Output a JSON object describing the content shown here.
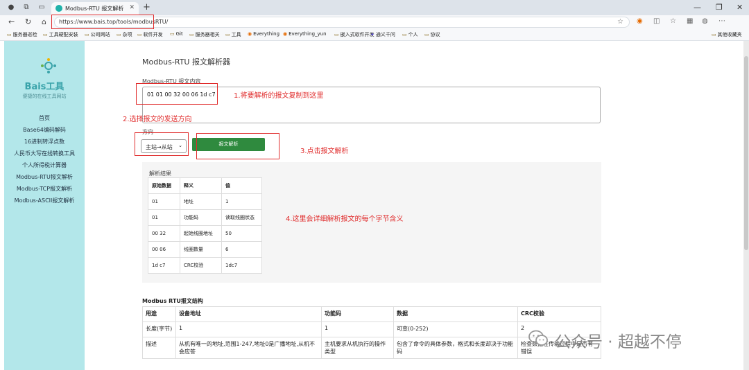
{
  "browser": {
    "tab_title": "Modbus-RTU 报文解析",
    "url": "https://www.bais.top/tools/modbusRTU/",
    "bookmarks": [
      "服务器巡检",
      "工具硬配安装",
      "公司网站",
      "杂项",
      "软件开发",
      "Git",
      "服务器相关",
      "工具",
      "Everything",
      "Everything_yun",
      "嵌入式软件开发",
      "通义千问",
      "个人",
      "协议"
    ],
    "other_bookmarks": "其他收藏夹"
  },
  "sidebar": {
    "brand": "Bais工具",
    "slogan": "便捷的在线工具网站",
    "items": [
      "首页",
      "Base64编码解码",
      "16进制转浮点数",
      "人民币大写在线转换工具",
      "个人所得税计算器",
      "Modbus-RTU报文解析",
      "Modbus-TCP报文解析",
      "Modbus-ASCII报文解析"
    ]
  },
  "main": {
    "title": "Modbus-RTU 报文解析器",
    "input_label": "Modbus-RTU 报文内容",
    "input_value": "01 01 00 32 00 06 1d c7",
    "direction_label": "方向",
    "direction_value": "主站→从站",
    "parse_button": "报文解析",
    "result_title": "解析结果",
    "result_headers": [
      "原始数据",
      "释义",
      "值"
    ],
    "result_rows": [
      [
        "01",
        "地址",
        "1"
      ],
      [
        "01",
        "功能码",
        "读取线圈状态"
      ],
      [
        "00 32",
        "起始线圈地址",
        "50"
      ],
      [
        "00 06",
        "线圈数量",
        "6"
      ],
      [
        "1d c7",
        "CRC校验",
        "1dc7"
      ]
    ],
    "structure_title": "Modbus RTU报文结构",
    "structure_headers": [
      "用途",
      "设备地址",
      "功能码",
      "数据",
      "CRC校验"
    ],
    "structure_rows": [
      [
        "长度(字节)",
        "1",
        "1",
        "可变(0-252)",
        "2"
      ],
      [
        "描述",
        "从机有唯一的地址,范围1-247,地址0是广播地址,从机不会应答",
        "主机要求从机执行的操作类型",
        "包含了命令的具体参数，格式和长度却决于功能码",
        "检查数据在传输过程中是否有错误"
      ]
    ]
  },
  "annotations": {
    "step1": "1.将要解析的报文复制到这里",
    "step2": "2.选择报文的发送方向",
    "step3": "3.点击报文解析",
    "step4": "4.这里会详细解析报文的每个字节含义"
  },
  "watermark": "公众号 · 超越不停",
  "colors": {
    "sidebar_bg": "#b3e7ea",
    "button_green": "#2f8a3e",
    "annotation_red": "#e02b2b"
  }
}
